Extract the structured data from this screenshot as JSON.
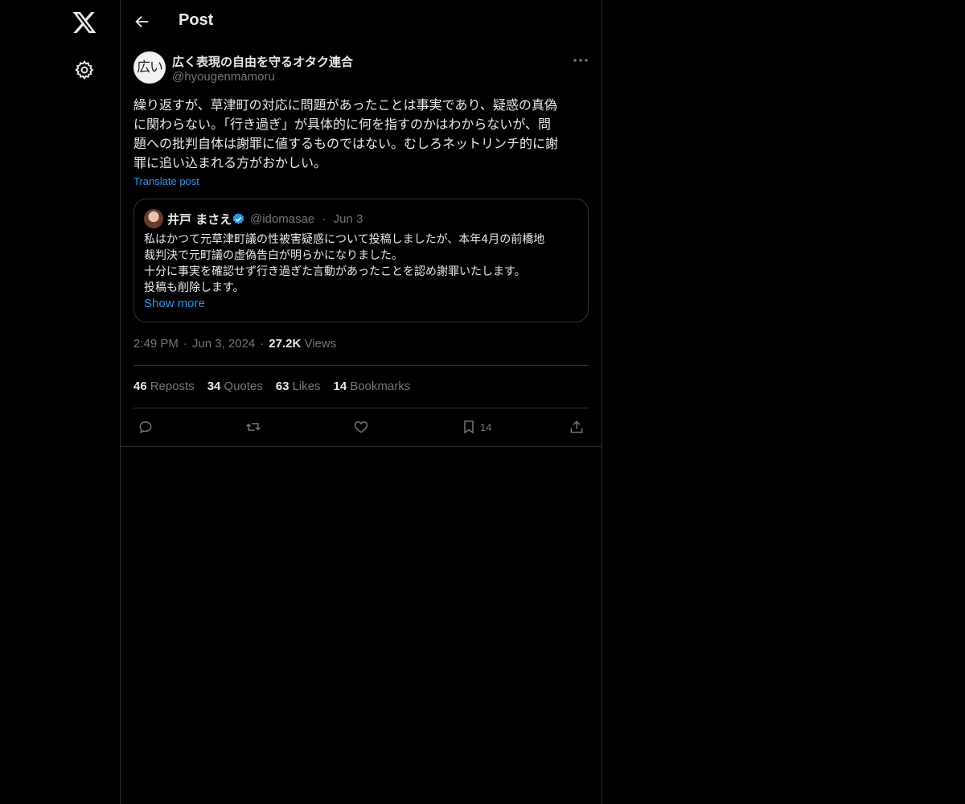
{
  "nav": {
    "logo_icon": "x-logo-icon",
    "settings_icon": "gear-icon"
  },
  "header": {
    "title": "Post"
  },
  "post": {
    "avatar_text": "広い",
    "author_name": "広く表現の自由を守るオタク連合",
    "author_handle": "@hyougenmamoru",
    "text": "繰り返すが、草津町の対応に問題があったことは事実であり、疑惑の真偽\nに関わらない。「行き過ぎ」が具体的に何を指すのかはわからないが、問\n題への批判自体は謝罪に値するものではない。むしろネットリンチ的に謝\n罪に追い込まれる方がおかしい。",
    "translate_label": "Translate post",
    "quote": {
      "name": "井戸 まさえ",
      "handle": "@idomasae",
      "separator": "·",
      "date": "Jun 3",
      "text": "私はかつて元草津町議の性被害疑惑について投稿しましたが、本年4月の前橋地\n裁判決で元町議の虚偽告白が明らかになりました。\n十分に事実を確認せず行き過ぎた言動があったことを認め謝罪いたします。\n投稿も削除します。",
      "show_more": "Show more"
    },
    "time": "2:49 PM",
    "date": "Jun 3, 2024",
    "separator": "·",
    "views_count": "27.2K",
    "views_label": "Views",
    "stats": [
      {
        "count": "46",
        "label": "Reposts"
      },
      {
        "count": "34",
        "label": "Quotes"
      },
      {
        "count": "63",
        "label": "Likes"
      },
      {
        "count": "14",
        "label": "Bookmarks"
      }
    ],
    "actions": {
      "bookmark_count": "14"
    }
  },
  "colors": {
    "background": "#000000",
    "text": "#e7e9ea",
    "muted": "#71767b",
    "accent": "#1d9bf0",
    "border": "#2f3336"
  }
}
